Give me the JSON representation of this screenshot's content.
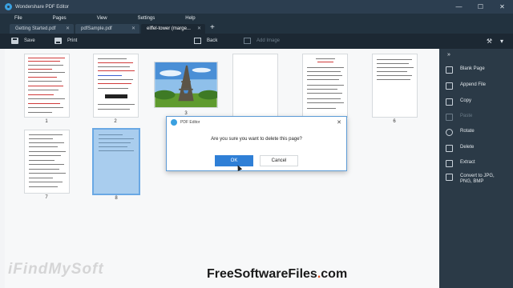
{
  "window": {
    "title": "Wondershare PDF Editor",
    "controls": [
      "—",
      "☐",
      "✕"
    ]
  },
  "menu": [
    "File",
    "Pages",
    "View",
    "Settings",
    "Help"
  ],
  "tabs": [
    {
      "label": "Getting Started.pdf",
      "active": false
    },
    {
      "label": "pdfSample.pdf",
      "active": false
    },
    {
      "label": "eiffel-tower (marge...",
      "active": true
    }
  ],
  "tab_add": "+",
  "toolbar": {
    "save": "Save",
    "print": "Print",
    "back": "Back",
    "add_image": "Add Image",
    "search_icon": "⚒",
    "settings_icon": "▾"
  },
  "pages": [
    {
      "number": "1"
    },
    {
      "number": "2"
    },
    {
      "number": "3"
    },
    {
      "number": "4"
    },
    {
      "number": "5"
    },
    {
      "number": "6"
    },
    {
      "number": "7"
    },
    {
      "number": "8"
    }
  ],
  "sidebar": {
    "collapse": "»",
    "items": [
      {
        "label": "Blank Page",
        "icon": "blank-page-icon",
        "enabled": true
      },
      {
        "label": "Append File",
        "icon": "append-file-icon",
        "enabled": true
      },
      {
        "label": "Copy",
        "icon": "copy-icon",
        "enabled": true
      },
      {
        "label": "Paste",
        "icon": "paste-icon",
        "enabled": false
      },
      {
        "label": "Rotate",
        "icon": "rotate-icon",
        "enabled": true
      },
      {
        "label": "Delete",
        "icon": "delete-icon",
        "enabled": true
      },
      {
        "label": "Extract",
        "icon": "extract-icon",
        "enabled": true
      },
      {
        "label": "Convert to JPG, PNG, BMP",
        "icon": "convert-icon",
        "enabled": true
      }
    ]
  },
  "dialog": {
    "title": "PDF Editor",
    "message": "Are you sure you want to delete this page?",
    "ok": "OK",
    "cancel": "Cancel",
    "close": "✕"
  },
  "watermark": {
    "left": "iFindMySoft",
    "right_main": "FreeSoftwareFiles",
    "right_dot": ".",
    "right_tld": "com"
  },
  "colors": {
    "chrome": "#1c2833",
    "accent": "#2f7fd6",
    "sidebar": "#2b3a47",
    "selected_page": "#a9cdee"
  }
}
